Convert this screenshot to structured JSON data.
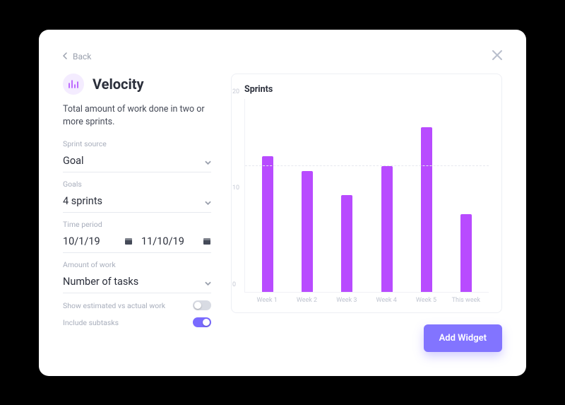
{
  "nav": {
    "back_label": "Back"
  },
  "header": {
    "title": "Velocity",
    "description": "Total amount of work done in two or more sprints."
  },
  "form": {
    "sprint_source": {
      "label": "Sprint source",
      "value": "Goal"
    },
    "goals": {
      "label": "Goals",
      "value": "4 sprints"
    },
    "time_period": {
      "label": "Time period",
      "from": "10/1/19",
      "to": "11/10/19"
    },
    "amount_of_work": {
      "label": "Amount of work",
      "value": "Number of tasks"
    },
    "show_estimated": {
      "label": "Show estimated vs actual work",
      "on": false
    },
    "include_subtasks": {
      "label": "Include subtasks",
      "on": true
    }
  },
  "chart_data": {
    "type": "bar",
    "title": "Sprints",
    "categories": [
      "Week 1",
      "Week 2",
      "Week 3",
      "Week 4",
      "Week 5",
      "This week"
    ],
    "values": [
      14,
      12.5,
      10,
      13,
      17,
      8
    ],
    "y_ticks": [
      0,
      10,
      20
    ],
    "reference": 13,
    "ylim": [
      0,
      20
    ],
    "bar_color": "#b84bff"
  },
  "actions": {
    "add_widget": "Add Widget"
  }
}
